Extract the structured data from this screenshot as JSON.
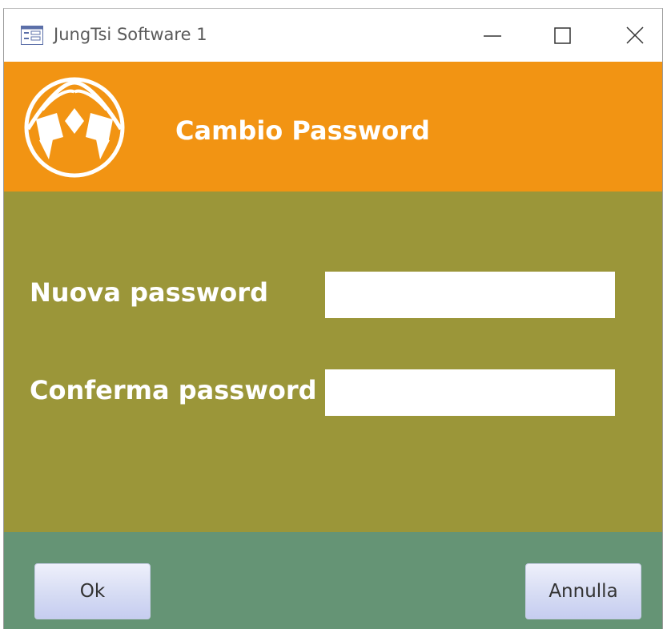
{
  "window": {
    "title": "JungTsi Software 1",
    "app_icon": "form-icon",
    "controls": [
      "minimize-icon",
      "maximize-icon",
      "close-icon"
    ]
  },
  "header": {
    "title": "Cambio Password",
    "logo": "jungtsi-logo",
    "background": "#f29413"
  },
  "form": {
    "background": "#9b9639",
    "new_password_label": "Nuova password",
    "new_password_value": "",
    "confirm_password_label": "Conferma password",
    "confirm_password_value": ""
  },
  "footer": {
    "background": "#659475",
    "ok_label": "Ok",
    "cancel_label": "Annulla"
  }
}
